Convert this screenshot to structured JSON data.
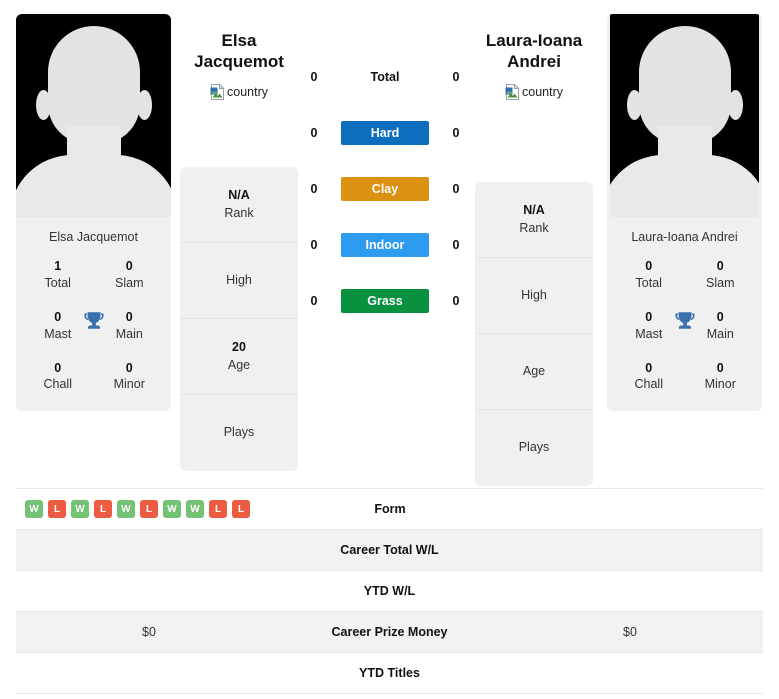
{
  "players": {
    "left": {
      "name": "Elsa Jacquemot",
      "name_line1": "Elsa",
      "name_line2": "Jacquemot",
      "country_alt": "country",
      "photo_alt": "player-photo-placeholder",
      "titles": [
        {
          "value": "1",
          "label": "Total"
        },
        {
          "value": "0",
          "label": "Slam"
        },
        {
          "value": "0",
          "label": "Mast"
        },
        {
          "value": "0",
          "label": "Main"
        },
        {
          "value": "0",
          "label": "Chall"
        },
        {
          "value": "0",
          "label": "Minor"
        }
      ],
      "info": [
        {
          "value": "N/A",
          "label": "Rank"
        },
        {
          "value": "",
          "label": "High"
        },
        {
          "value": "20",
          "label": "Age"
        },
        {
          "value": "",
          "label": "Plays"
        }
      ],
      "career_prize_money": "$0",
      "career_total_wl": "",
      "ytd_wl": "",
      "ytd_titles": ""
    },
    "right": {
      "name": "Laura-Ioana Andrei",
      "name_line1": "Laura-Ioana",
      "name_line2": "Andrei",
      "country_alt": "country",
      "photo_alt": "player-photo-placeholder",
      "titles": [
        {
          "value": "0",
          "label": "Total"
        },
        {
          "value": "0",
          "label": "Slam"
        },
        {
          "value": "0",
          "label": "Mast"
        },
        {
          "value": "0",
          "label": "Main"
        },
        {
          "value": "0",
          "label": "Chall"
        },
        {
          "value": "0",
          "label": "Minor"
        }
      ],
      "info": [
        {
          "value": "N/A",
          "label": "Rank"
        },
        {
          "value": "",
          "label": "High"
        },
        {
          "value": "",
          "label": "Age"
        },
        {
          "value": "",
          "label": "Plays"
        }
      ],
      "career_prize_money": "$0",
      "career_total_wl": "",
      "ytd_wl": "",
      "ytd_titles": ""
    }
  },
  "head_to_head": {
    "rows": [
      {
        "label": "Total",
        "left": "0",
        "right": "0",
        "color": "none",
        "style": "plain"
      },
      {
        "label": "Hard",
        "left": "0",
        "right": "0",
        "color": "#0d6ebd",
        "style": "badge"
      },
      {
        "label": "Clay",
        "left": "0",
        "right": "0",
        "color": "#dd9110",
        "style": "badge"
      },
      {
        "label": "Indoor",
        "left": "0",
        "right": "0",
        "color": "#2d9bf0",
        "style": "badge"
      },
      {
        "label": "Grass",
        "left": "0",
        "right": "0",
        "color": "#0a9140",
        "style": "badge"
      }
    ]
  },
  "form": {
    "label": "Form",
    "left_results": [
      "W",
      "L",
      "W",
      "L",
      "W",
      "L",
      "W",
      "W",
      "L",
      "L"
    ],
    "right_results": [],
    "win_color": "#74c274",
    "loss_color": "#ed5b43"
  },
  "stats_rows": [
    {
      "label": "Career Total W/L",
      "left": "",
      "right": "",
      "striped": true
    },
    {
      "label": "YTD W/L",
      "left": "",
      "right": "",
      "striped": false
    },
    {
      "label": "Career Prize Money",
      "left": "$0",
      "right": "$0",
      "striped": true
    },
    {
      "label": "YTD Titles",
      "left": "",
      "right": "",
      "striped": false
    }
  ],
  "colors": {
    "trophy": "#3b6fad",
    "card_bg": "#f0f0f0",
    "stripe_bg": "#f2f2f2",
    "photo_bg": "#000000",
    "silhouette": "#e6e6e6"
  }
}
